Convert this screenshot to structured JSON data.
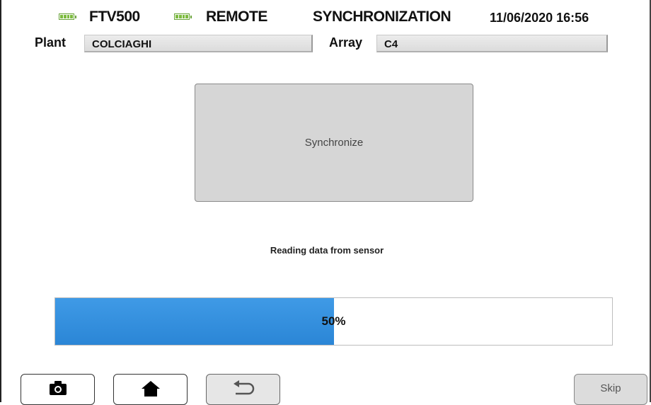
{
  "header": {
    "device": "FTV500",
    "mode": "REMOTE",
    "screen": "SYNCHRONIZATION",
    "datetime": "11/06/2020 16:56"
  },
  "fields": {
    "plant_label": "Plant",
    "plant_value": "COLCIAGHI",
    "array_label": "Array",
    "array_value": "C4"
  },
  "main": {
    "sync_button_label": "Synchronize",
    "status_text": "Reading data from sensor",
    "progress_label": "50%",
    "progress_fraction": 0.5
  },
  "footer": {
    "skip_label": "Skip"
  },
  "colors": {
    "progress_fill": "#2b86d6",
    "battery": "#7dbb3f"
  },
  "icons": [
    "battery-icon",
    "camera-icon",
    "home-icon",
    "back-arrow-icon"
  ]
}
